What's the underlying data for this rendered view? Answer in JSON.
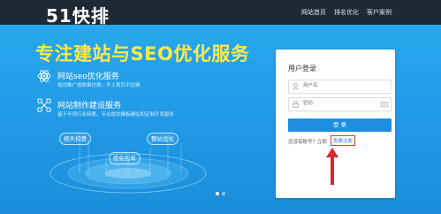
{
  "header": {
    "logo": "51快排",
    "nav": [
      "网站首页",
      "排名优化",
      "客户案例"
    ]
  },
  "hero": {
    "headline": "专注建站与SEO优化服务",
    "features": [
      {
        "title": "网站seo优化服务",
        "desc": "按词推广按效果付费，不上首页不扣费",
        "icon": "atom-icon"
      },
      {
        "title": "网站制作建设服务",
        "desc": "基于不同行业特质，专业提供模板建站和定制开发服务",
        "icon": "network-icon"
      }
    ],
    "pills": [
      "按天扣费",
      "整站优化",
      "优化包年"
    ]
  },
  "login": {
    "title": "用户登录",
    "username_placeholder": "用户名",
    "password_placeholder": "密码",
    "button": "登 录",
    "register_prompt": "还没有账号？立即",
    "register_link": "免费注册"
  },
  "colors": {
    "topbar": "#1e2a33",
    "hero": "#29a8ee",
    "headline": "#ffe94a",
    "button": "#1e8fe0",
    "highlight": "#e23a2f"
  }
}
